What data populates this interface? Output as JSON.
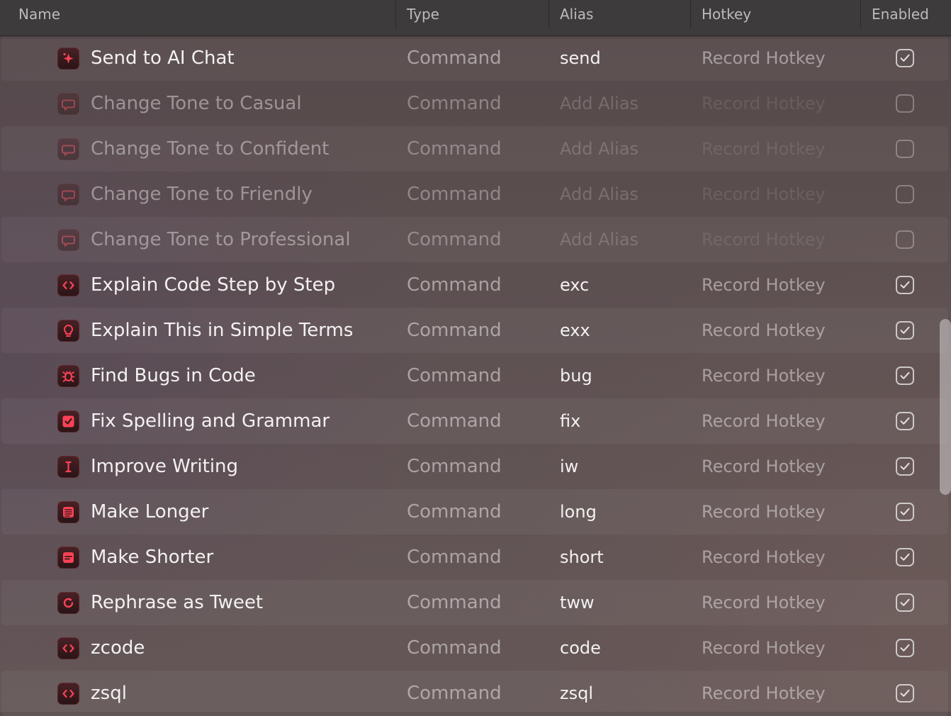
{
  "columns": {
    "name": "Name",
    "type": "Type",
    "alias": "Alias",
    "hotkey": "Hotkey",
    "enabled": "Enabled"
  },
  "rows": [
    {
      "name": "Send to AI Chat",
      "type": "Command",
      "alias": "send",
      "hotkey": "Record Hotkey",
      "enabled": true,
      "icon": "sparkle-icon"
    },
    {
      "name": "Change Tone to Casual",
      "type": "Command",
      "alias": "Add Alias",
      "hotkey": "Record Hotkey",
      "enabled": false,
      "icon": "speech-bubble-icon"
    },
    {
      "name": "Change Tone to Confident",
      "type": "Command",
      "alias": "Add Alias",
      "hotkey": "Record Hotkey",
      "enabled": false,
      "icon": "speech-bubble-icon"
    },
    {
      "name": "Change Tone to Friendly",
      "type": "Command",
      "alias": "Add Alias",
      "hotkey": "Record Hotkey",
      "enabled": false,
      "icon": "speech-bubble-icon"
    },
    {
      "name": "Change Tone to Professional",
      "type": "Command",
      "alias": "Add Alias",
      "hotkey": "Record Hotkey",
      "enabled": false,
      "icon": "speech-bubble-icon"
    },
    {
      "name": "Explain Code Step by Step",
      "type": "Command",
      "alias": "exc",
      "hotkey": "Record Hotkey",
      "enabled": true,
      "icon": "code-brackets-icon"
    },
    {
      "name": "Explain This in Simple Terms",
      "type": "Command",
      "alias": "exx",
      "hotkey": "Record Hotkey",
      "enabled": true,
      "icon": "light-bulb-icon"
    },
    {
      "name": "Find Bugs in Code",
      "type": "Command",
      "alias": "bug",
      "hotkey": "Record Hotkey",
      "enabled": true,
      "icon": "bug-icon"
    },
    {
      "name": "Fix Spelling and Grammar",
      "type": "Command",
      "alias": "fix",
      "hotkey": "Record Hotkey",
      "enabled": true,
      "icon": "checkmark-icon"
    },
    {
      "name": "Improve Writing",
      "type": "Command",
      "alias": "iw",
      "hotkey": "Record Hotkey",
      "enabled": true,
      "icon": "text-cursor-icon"
    },
    {
      "name": "Make Longer",
      "type": "Command",
      "alias": "long",
      "hotkey": "Record Hotkey",
      "enabled": true,
      "icon": "text-lines-icon"
    },
    {
      "name": "Make Shorter",
      "type": "Command",
      "alias": "short",
      "hotkey": "Record Hotkey",
      "enabled": true,
      "icon": "short-text-icon"
    },
    {
      "name": "Rephrase as Tweet",
      "type": "Command",
      "alias": "tww",
      "hotkey": "Record Hotkey",
      "enabled": true,
      "icon": "rotate-arrow-icon"
    },
    {
      "name": "zcode",
      "type": "Command",
      "alias": "code",
      "hotkey": "Record Hotkey",
      "enabled": true,
      "icon": "code-brackets-icon"
    },
    {
      "name": "zsql",
      "type": "Command",
      "alias": "zsql",
      "hotkey": "Record Hotkey",
      "enabled": true,
      "icon": "code-brackets-icon"
    }
  ],
  "colors": {
    "accent": "#ff4256",
    "icon_bg": "#3a1a1d"
  }
}
